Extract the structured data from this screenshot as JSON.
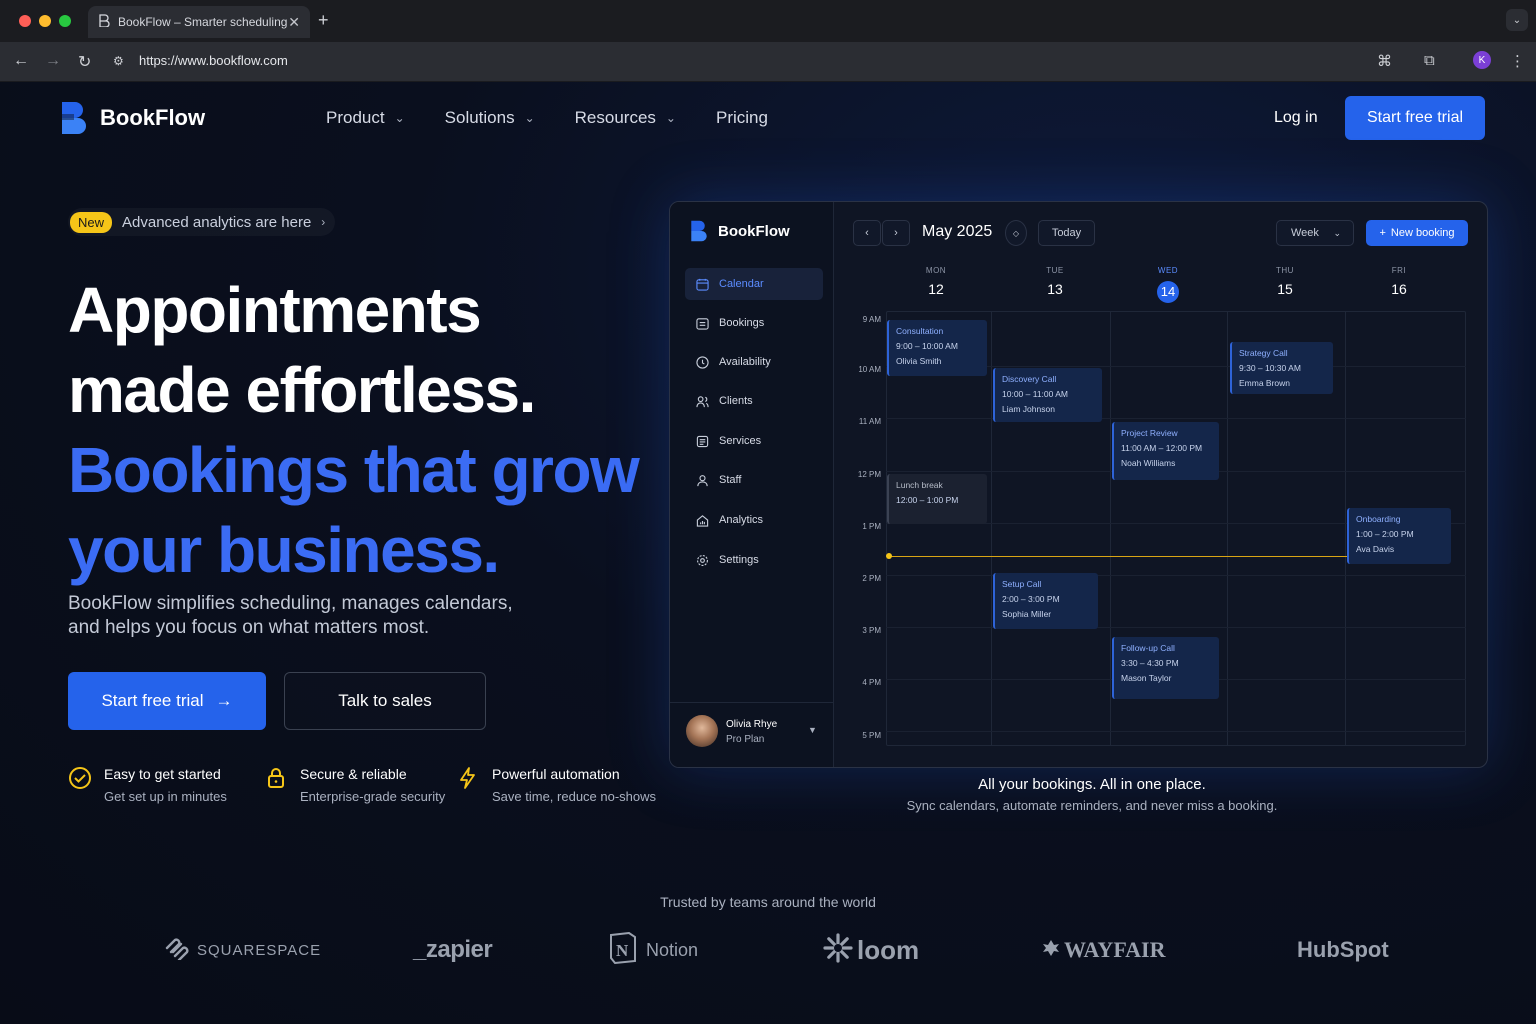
{
  "browser": {
    "tab_title": "BookFlow – Smarter scheduling",
    "url": "https://www.bookflow.com",
    "profile_initial": "K"
  },
  "header": {
    "brand": "BookFlow",
    "nav": [
      "Product",
      "Solutions",
      "Resources",
      "Pricing"
    ],
    "login": "Log in",
    "cta": "Start free trial"
  },
  "hero": {
    "badge_new": "New",
    "badge_text": "Advanced analytics are here",
    "title_line1": "Appointments",
    "title_line2": "made effortless.",
    "title_line3": "Bookings that grow",
    "title_line4": "your business.",
    "subtitle_line1": "BookFlow simplifies scheduling, manages calendars,",
    "subtitle_line2": "and helps you focus on what matters most.",
    "primary_cta": "Start free trial",
    "secondary_cta": "Talk to sales",
    "features": [
      {
        "title": "Easy to get started",
        "desc": "Get set up in minutes",
        "icon": "check-circle-icon"
      },
      {
        "title": "Secure & reliable",
        "desc": "Enterprise-grade security",
        "icon": "lock-icon"
      },
      {
        "title": "Powerful automation",
        "desc": "Save time, reduce no-shows",
        "icon": "lightning-icon"
      }
    ]
  },
  "app": {
    "brand": "BookFlow",
    "sidebar": [
      "Calendar",
      "Bookings",
      "Availability",
      "Clients",
      "Services",
      "Staff",
      "Analytics",
      "Settings"
    ],
    "user_name": "Olivia Rhye",
    "user_plan": "Pro Plan",
    "month": "May 2025",
    "today_label": "Today",
    "view_label": "Week",
    "new_booking": "New booking",
    "days": [
      {
        "name": "MON",
        "date": "12"
      },
      {
        "name": "TUE",
        "date": "13"
      },
      {
        "name": "WED",
        "date": "14"
      },
      {
        "name": "THU",
        "date": "15"
      },
      {
        "name": "FRI",
        "date": "16"
      }
    ],
    "times": [
      "9 AM",
      "10 AM",
      "11 AM",
      "12 PM",
      "1 PM",
      "2 PM",
      "3 PM",
      "4 PM",
      "5 PM"
    ],
    "events": [
      {
        "title": "Consultation",
        "time": "9:00 – 10:00 AM",
        "person": "Olivia Smith"
      },
      {
        "title": "Discovery Call",
        "time": "10:00 – 11:00 AM",
        "person": "Liam Johnson"
      },
      {
        "title": "Strategy Call",
        "time": "9:30 – 10:30 AM",
        "person": "Emma Brown"
      },
      {
        "title": "Project Review",
        "time": "11:00 AM – 12:00 PM",
        "person": "Noah Williams"
      },
      {
        "title": "Lunch break",
        "time": "12:00 – 1:00 PM"
      },
      {
        "title": "Onboarding",
        "time": "1:00 – 2:00 PM",
        "person": "Ava Davis"
      },
      {
        "title": "Setup Call",
        "time": "2:00 – 3:00 PM",
        "person": "Sophia Miller"
      },
      {
        "title": "Follow-up Call",
        "time": "3:30 – 4:30 PM",
        "person": "Mason Taylor"
      }
    ]
  },
  "caption": {
    "title": "All your bookings. All in one place.",
    "subtitle": "Sync calendars, automate reminders, and never miss a booking."
  },
  "trusted": {
    "label": "Trusted by teams around the world",
    "logos": [
      "SQUARESPACE",
      "_zapier",
      "Notion",
      "loom",
      "WAYFAIR",
      "HubSpot"
    ]
  },
  "colors": {
    "accent": "#2563eb",
    "headline_blue": "#3b6cf4",
    "badge_yellow": "#f5c518",
    "background": "#0a0f1e"
  }
}
